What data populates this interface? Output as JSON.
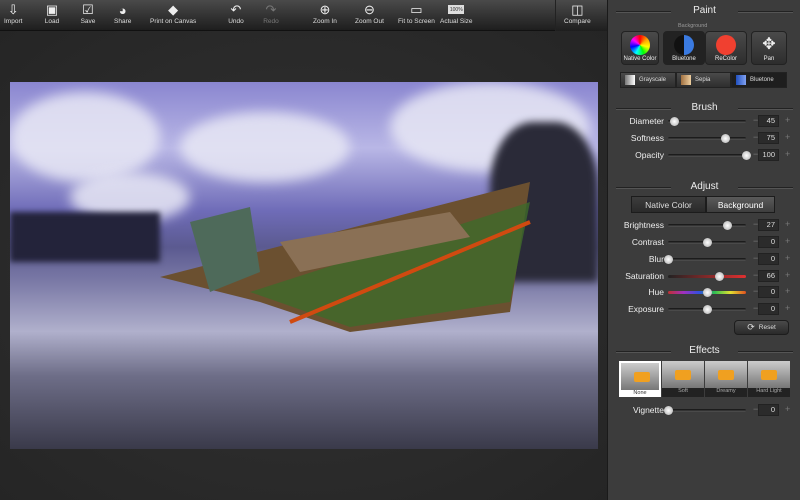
{
  "toolbar": {
    "items": [
      {
        "label": "Import",
        "icon": "import-icon"
      },
      {
        "label": "Load",
        "icon": "load-icon"
      },
      {
        "label": "Save",
        "icon": "save-icon"
      },
      {
        "label": "Share",
        "icon": "share-icon"
      },
      {
        "label": "Print on Canvas",
        "icon": "print-icon"
      },
      {
        "label": "Undo",
        "icon": "undo-icon"
      },
      {
        "label": "Redo",
        "icon": "redo-icon",
        "disabled": true
      },
      {
        "label": "Zoom In",
        "icon": "zoom-in-icon"
      },
      {
        "label": "Zoom Out",
        "icon": "zoom-out-icon"
      },
      {
        "label": "Fit to Screen",
        "icon": "fit-icon"
      },
      {
        "label": "Actual Size",
        "icon": "actual-size-icon",
        "badge": "100%"
      }
    ],
    "compare": "Compare"
  },
  "paint": {
    "title": "Paint",
    "background_label": "Background",
    "buttons": [
      "Native Color",
      "Bluetone",
      "ReColor",
      "Pan"
    ],
    "tones": [
      "Grayscale",
      "Sepia",
      "Bluetone"
    ],
    "selected_tone": "Bluetone"
  },
  "brush": {
    "title": "Brush",
    "sliders": [
      {
        "label": "Diameter",
        "value": "45",
        "fraction": 0.08
      },
      {
        "label": "Softness",
        "value": "75",
        "fraction": 0.73
      },
      {
        "label": "Opacity",
        "value": "100",
        "fraction": 1.0
      }
    ]
  },
  "adjust": {
    "title": "Adjust",
    "tabs": [
      "Native Color",
      "Background"
    ],
    "active_tab": "Background",
    "sliders": [
      {
        "label": "Brightness",
        "value": "27",
        "fraction": 0.75
      },
      {
        "label": "Contrast",
        "value": "0",
        "fraction": 0.5
      },
      {
        "label": "Blur",
        "value": "0",
        "fraction": 0.0
      },
      {
        "label": "Saturation",
        "value": "66",
        "fraction": 0.65
      },
      {
        "label": "Hue",
        "value": "0",
        "fraction": 0.5
      },
      {
        "label": "Exposure",
        "value": "0",
        "fraction": 0.5
      }
    ],
    "reset": "Reset"
  },
  "effects": {
    "title": "Effects",
    "items": [
      "None",
      "Soft",
      "Dreamy",
      "Hard Light"
    ],
    "selected": "None",
    "vignette": {
      "label": "Vignette",
      "value": "0",
      "fraction": 0.0
    }
  },
  "pm": {
    "minus": "−",
    "plus": "+"
  }
}
